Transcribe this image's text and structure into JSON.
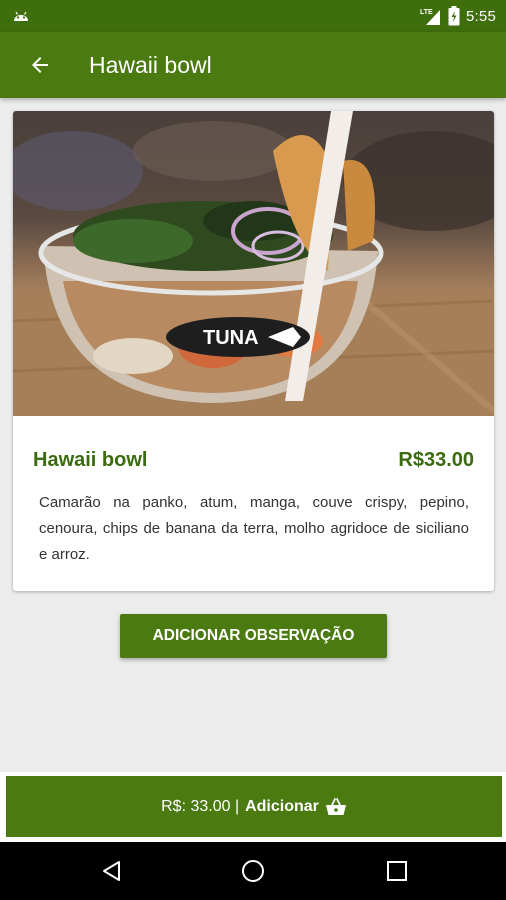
{
  "status_bar": {
    "network": "LTE",
    "time": "5:55"
  },
  "app_bar": {
    "title": "Hawaii bowl"
  },
  "product": {
    "name": "Hawaii bowl",
    "price": "R$33.00",
    "description": "Camarão na panko, atum, manga, couve crispy, pepino, cenoura, chips de banana da terra, molho agridoce de siciliano e arroz.",
    "image_logo_text": "TUNA"
  },
  "actions": {
    "observation_label": "ADICIONAR OBSERVAÇÃO",
    "total_text": "R$: 33.00 |",
    "add_label": "Adicionar"
  },
  "colors": {
    "primary": "#4a7a10",
    "status_bar": "#3f6e0c",
    "accent_text": "#3b6b10",
    "background": "#ececec"
  },
  "icons": {
    "status": [
      "android-icon",
      "lte-signal-icon",
      "battery-icon"
    ],
    "app_bar": [
      "back-arrow-icon"
    ],
    "add_bar": [
      "basket-icon"
    ],
    "nav": [
      "nav-back-icon",
      "nav-home-icon",
      "nav-recents-icon"
    ]
  }
}
